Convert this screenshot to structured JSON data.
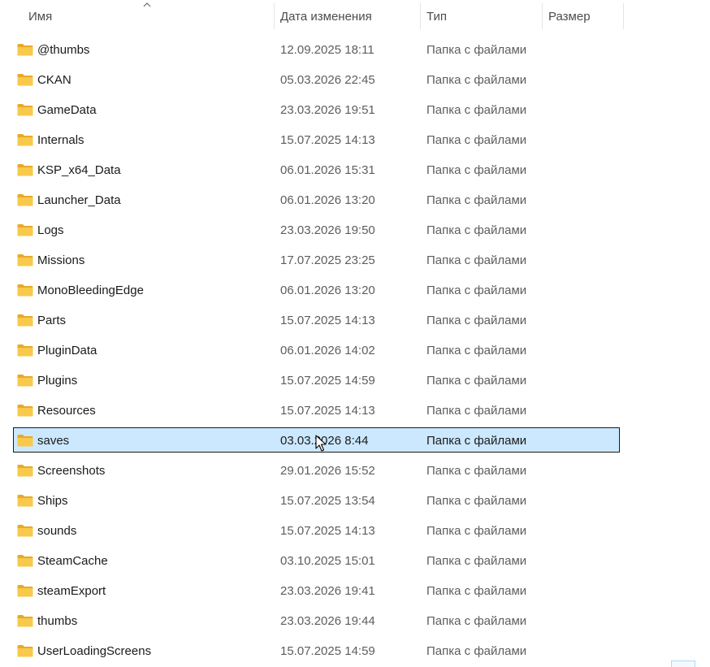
{
  "columns": {
    "name": "Имя",
    "date": "Дата изменения",
    "type": "Тип",
    "size": "Размер"
  },
  "sort": {
    "column": "name",
    "direction": "ascending",
    "icon": "sort-up-icon"
  },
  "colors": {
    "folder": "#f8c94a",
    "folder_dark": "#e8a92a",
    "selection_bg": "#cce8ff"
  },
  "rows": [
    {
      "name": "@thumbs",
      "date": "12.09.2025 18:11",
      "type": "Папка с файлами",
      "icon": "folder-icon"
    },
    {
      "name": "CKAN",
      "date": "05.03.2026 22:45",
      "type": "Папка с файлами",
      "icon": "folder-icon"
    },
    {
      "name": "GameData",
      "date": "23.03.2026 19:51",
      "type": "Папка с файлами",
      "icon": "folder-icon"
    },
    {
      "name": "Internals",
      "date": "15.07.2025 14:13",
      "type": "Папка с файлами",
      "icon": "folder-icon"
    },
    {
      "name": "KSP_x64_Data",
      "date": "06.01.2026 15:31",
      "type": "Папка с файлами",
      "icon": "folder-icon"
    },
    {
      "name": "Launcher_Data",
      "date": "06.01.2026 13:20",
      "type": "Папка с файлами",
      "icon": "folder-icon"
    },
    {
      "name": "Logs",
      "date": "23.03.2026 19:50",
      "type": "Папка с файлами",
      "icon": "folder-icon"
    },
    {
      "name": "Missions",
      "date": "17.07.2025 23:25",
      "type": "Папка с файлами",
      "icon": "folder-icon"
    },
    {
      "name": "MonoBleedingEdge",
      "date": "06.01.2026 13:20",
      "type": "Папка с файлами",
      "icon": "folder-icon"
    },
    {
      "name": "Parts",
      "date": "15.07.2025 14:13",
      "type": "Папка с файлами",
      "icon": "folder-icon"
    },
    {
      "name": "PluginData",
      "date": "06.01.2026 14:02",
      "type": "Папка с файлами",
      "icon": "folder-icon"
    },
    {
      "name": "Plugins",
      "date": "15.07.2025 14:59",
      "type": "Папка с файлами",
      "icon": "folder-icon"
    },
    {
      "name": "Resources",
      "date": "15.07.2025 14:13",
      "type": "Папка с файлами",
      "icon": "folder-icon"
    },
    {
      "name": "saves",
      "date": "03.03.2026 8:44",
      "type": "Папка с файлами",
      "icon": "folder-icon",
      "selected": true
    },
    {
      "name": "Screenshots",
      "date": "29.01.2026 15:52",
      "type": "Папка с файлами",
      "icon": "folder-icon"
    },
    {
      "name": "Ships",
      "date": "15.07.2025 13:54",
      "type": "Папка с файлами",
      "icon": "folder-icon"
    },
    {
      "name": "sounds",
      "date": "15.07.2025 14:13",
      "type": "Папка с файлами",
      "icon": "folder-icon"
    },
    {
      "name": "SteamCache",
      "date": "03.10.2025 15:01",
      "type": "Папка с файлами",
      "icon": "folder-icon"
    },
    {
      "name": "steamExport",
      "date": "23.03.2026 19:41",
      "type": "Папка с файлами",
      "icon": "folder-icon"
    },
    {
      "name": "thumbs",
      "date": "23.03.2026 19:44",
      "type": "Папка с файлами",
      "icon": "folder-icon"
    },
    {
      "name": "UserLoadingScreens",
      "date": "15.07.2025 14:59",
      "type": "Папка с файлами",
      "icon": "folder-icon"
    }
  ]
}
